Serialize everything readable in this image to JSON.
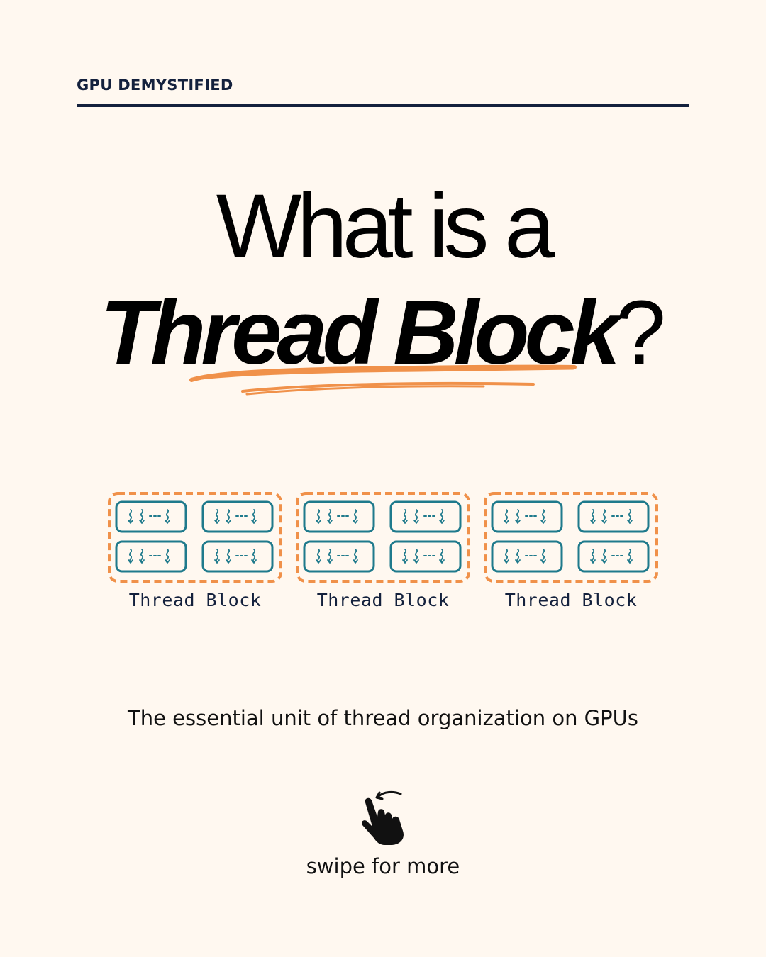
{
  "header": {
    "kicker": "GPU DEMYSTIFIED"
  },
  "title": {
    "line1": "What is a",
    "emphasis": "Thread Block",
    "punctuation": "?"
  },
  "colors": {
    "background": "#fff8f0",
    "navy": "#14213d",
    "accent_orange": "#f0914a",
    "thread_teal": "#1f7a8c"
  },
  "diagram": {
    "blocks": [
      {
        "label": "Thread Block"
      },
      {
        "label": "Thread Block"
      },
      {
        "label": "Thread Block"
      }
    ],
    "thread_icon": "wavy-thread-arrows-icon"
  },
  "tagline": "The essential unit of thread organization on GPUs",
  "footer": {
    "swipe_icon": "swipe-hand-icon",
    "swipe_label": "swipe for more"
  }
}
